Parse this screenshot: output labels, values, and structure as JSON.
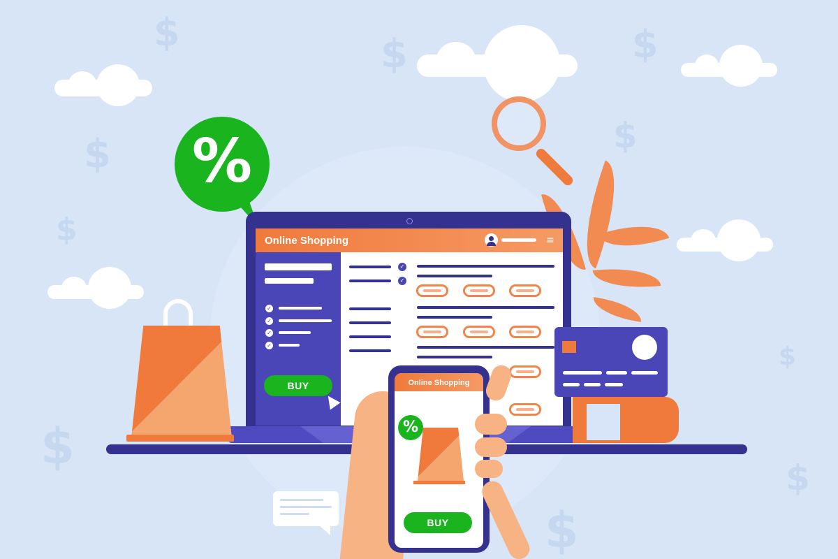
{
  "laptop": {
    "title": "Online Shopping",
    "buy_label": "BUY",
    "menu_icon": "≡"
  },
  "phone": {
    "title": "Online Shopping",
    "buy_label": "BUY",
    "discount_symbol": "%"
  },
  "bubble": {
    "symbol": "%"
  },
  "decorations": {
    "dollar_symbol": "$"
  },
  "colors": {
    "background": "#d7e5f7",
    "navy": "#34318f",
    "indigo": "#4b46b8",
    "orange": "#f07a3c",
    "green": "#1ab41e"
  }
}
